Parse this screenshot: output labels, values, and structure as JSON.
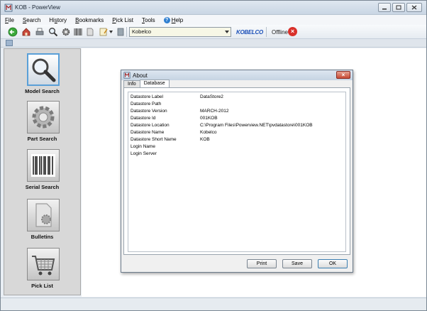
{
  "window": {
    "title": "KOB - PowerView"
  },
  "menu": {
    "file": {
      "u": "F",
      "rest": "ile"
    },
    "search": {
      "u": "S",
      "rest": "earch"
    },
    "history": {
      "pre": "Hi",
      "u": "s",
      "rest": "tory"
    },
    "bookmarks": {
      "u": "B",
      "rest": "ookmarks"
    },
    "picklist": {
      "u": "P",
      "rest": "ick List"
    },
    "tools": {
      "u": "T",
      "rest": "ools"
    },
    "help": {
      "u": "H",
      "rest": "elp"
    }
  },
  "toolbar": {
    "datastore_value": "Kobelco",
    "brand": "KOBELCO",
    "status": "Offline"
  },
  "sidebar": {
    "items": [
      {
        "label": "Model Search",
        "icon": "magnifier-icon"
      },
      {
        "label": "Part Search",
        "icon": "gear-icon"
      },
      {
        "label": "Serial Search",
        "icon": "barcode-icon"
      },
      {
        "label": "Bulletins",
        "icon": "document-icon"
      },
      {
        "label": "Pick List",
        "icon": "shopping-cart-icon"
      }
    ]
  },
  "dialog": {
    "title": "About",
    "tabs": [
      {
        "label": "Info"
      },
      {
        "label": "Database"
      }
    ],
    "rows": [
      {
        "key": "Datastore Label",
        "value": "DataStore2"
      },
      {
        "key": "Datastore Path",
        "value": ""
      },
      {
        "key": "Datastore Version",
        "value": "MARCH-2012"
      },
      {
        "key": "Datastore Id",
        "value": "001KOB"
      },
      {
        "key": "Datastore Location",
        "value": "C:\\Program Files\\Powerview.NET\\pvdatastore\\001KOB"
      },
      {
        "key": "Datastore Name",
        "value": "Kobelco"
      },
      {
        "key": "Datastore Short Name",
        "value": "KOB"
      },
      {
        "key": "Login Name",
        "value": ""
      },
      {
        "key": "Login Server",
        "value": ""
      }
    ],
    "buttons": {
      "print": "Print",
      "save": "Save",
      "ok": "OK"
    }
  },
  "colors": {
    "accent": "#5aa0d8",
    "offline": "#d9302a",
    "brand": "#1a4fb8"
  }
}
